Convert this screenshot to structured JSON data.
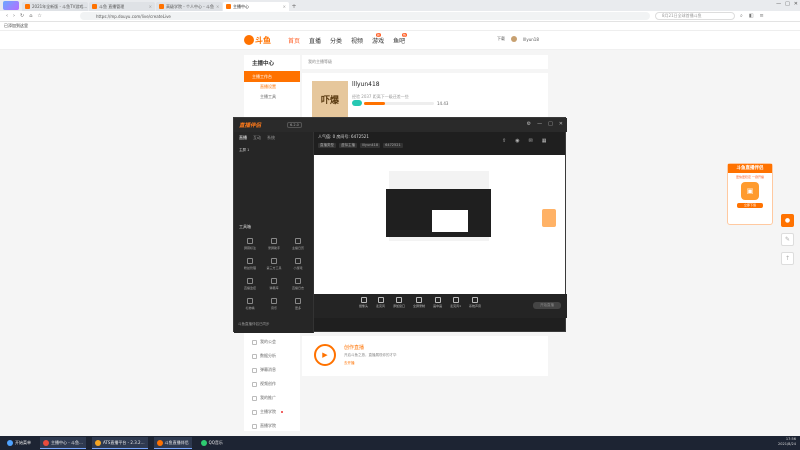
{
  "browser": {
    "tabs": [
      {
        "title": "2021年全新版 - 斗鱼TV游戏…",
        "color": "#ff7200",
        "active": false
      },
      {
        "title": "斗鱼 直播管理",
        "color": "#ff7200",
        "active": false
      },
      {
        "title": "高级学院 - 个人中心 - 斗鱼",
        "color": "#ff7200",
        "active": false
      },
      {
        "title": "主播中心",
        "color": "#ff7200",
        "active": true
      }
    ],
    "url": "https://mp.douyu.com/live/createLive",
    "search_placeholder": "8月21日全球首播斗鱼",
    "bookmark": "已添加到这里"
  },
  "site": {
    "logo_text": "斗鱼",
    "nav": [
      "首页",
      "直播",
      "分类",
      "视频",
      "游戏",
      "鱼吧"
    ],
    "nav_badges": {
      "视频": "新",
      "游戏": "热"
    },
    "user": [
      "下载",
      "lllyun18"
    ]
  },
  "sidebar": {
    "title": "主播中心",
    "active_item": "主播工作台",
    "subitems": [
      "直播设置",
      "主播工具"
    ],
    "lower_items": [
      {
        "label": "我的公会",
        "dot": false
      },
      {
        "label": "数据分析",
        "dot": false
      },
      {
        "label": "弹幕消息",
        "dot": false
      },
      {
        "label": "视频创作",
        "dot": false
      },
      {
        "label": "我的推广",
        "dot": false
      },
      {
        "label": "主播学院",
        "dot": true
      },
      {
        "label": "直播学院",
        "dot": false
      }
    ]
  },
  "main": {
    "notice": "我的主播等级",
    "profile_name": "lllyun418",
    "profile_level_text": "经验 2037 距离下一级还差一些",
    "level_badge": "LV",
    "progress_text": "14.43",
    "progress_fraction": 0.3,
    "avatar_text": "吓爆",
    "creative_title": "创作直播",
    "creative_desc": "开启斗鱼之旅，直播展现你的才华",
    "creative_go": "去开播"
  },
  "app_window": {
    "title": "直播伴侣",
    "version": "6.2.0",
    "controls": [
      "⚙",
      "—",
      "□",
      "✕"
    ],
    "tabs": [
      "直播",
      "互动",
      "系统"
    ],
    "scene": "主屏 1",
    "room_info": "人气值: 0    房间号: 6472521",
    "tags": [
      "直播类型",
      "虚拟主播",
      "lllyun418",
      "6472521"
    ],
    "toolbox_title": "工具箱",
    "tools": [
      "屏幕标注",
      "录屏助手",
      "主播日历",
      "粉丝管理",
      "第三方工具",
      "小游戏",
      "直播监控",
      "弹幕库",
      "直播日志",
      "礼物墙",
      "音乐",
      "更多"
    ],
    "footer_text": "斗鱼直播伴侣已同步",
    "bottom_actions": [
      "摄像头",
      "麦克风",
      "添加窗口",
      "全屏录制",
      "画中画",
      "麦克风1",
      "系统声音"
    ],
    "live_button": "开始直播"
  },
  "right_float": {
    "title": "斗鱼直播伴侣",
    "subtitle": "更快更稳定 一键开播",
    "button": "立即下载"
  },
  "taskbar": {
    "items": [
      {
        "label": "开始菜单",
        "color": "#4fa3ff",
        "open": false
      },
      {
        "label": "主播中心 - 斗鱼…",
        "color": "#e94b3c",
        "open": true
      },
      {
        "label": "ATS直播平台 - 2.3.2…",
        "color": "#f5a623",
        "open": true
      },
      {
        "label": "斗鱼直播伴侣",
        "color": "#ff7200",
        "open": true
      },
      {
        "label": "QQ音乐",
        "color": "#2ecc71",
        "open": false
      }
    ],
    "time": "17:56",
    "date": "2021/8/24"
  },
  "colors": {
    "brand": "#ff7200",
    "dark": "#1f1f1f",
    "taskbar": "#1d2433"
  }
}
